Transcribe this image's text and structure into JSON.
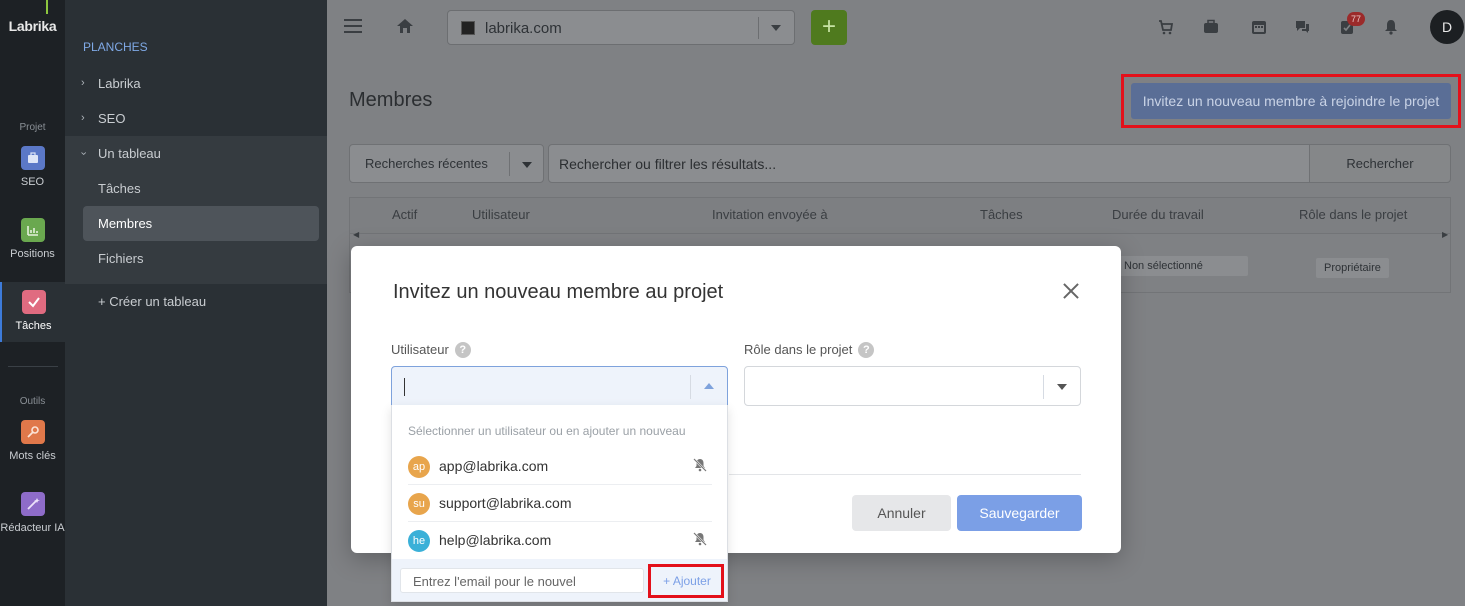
{
  "rail": {
    "logo": "Labrika",
    "section_project": "Projet",
    "items": [
      {
        "label": "SEO",
        "icon": "briefcase-icon",
        "color": "#5b78c7"
      },
      {
        "label": "Positions",
        "icon": "chart-icon",
        "color": "#6aa84f"
      },
      {
        "label": "Tâches",
        "icon": "check-icon",
        "color": "#e06b80"
      },
      {
        "label": "Mots clés",
        "icon": "key-icon",
        "color": "#e0784a"
      },
      {
        "label": "Rédacteur IA",
        "icon": "wand-icon",
        "color": "#8e6cc9"
      }
    ],
    "section_tools": "Outils"
  },
  "sidebar": {
    "heading": "PLANCHES",
    "boards": [
      {
        "label": "Labrika"
      },
      {
        "label": "SEO"
      },
      {
        "label": "Un tableau"
      }
    ],
    "sub_items": [
      {
        "label": "Tâches"
      },
      {
        "label": "Membres"
      },
      {
        "label": "Fichiers"
      }
    ],
    "create": "+ Créer un tableau"
  },
  "topbar": {
    "site": "labrika.com",
    "add_label": "+",
    "badge_count": "77",
    "avatar_initial": "D"
  },
  "page": {
    "title": "Membres",
    "invite_button": "Invitez un nouveau membre à rejoindre le projet",
    "recent_searches": "Recherches récentes",
    "search_placeholder": "Rechercher ou filtrer les résultats...",
    "search_button": "Rechercher",
    "columns": [
      "Actif",
      "Utilisateur",
      "Invitation envoyée à",
      "Tâches",
      "Durée du travail",
      "Rôle dans le projet"
    ],
    "row": {
      "duration": "Non sélectionné",
      "role": "Propriétaire"
    }
  },
  "modal": {
    "title": "Invitez un nouveau membre au projet",
    "user_label": "Utilisateur",
    "role_label": "Rôle dans le projet",
    "help_glyph": "?",
    "cancel": "Annuler",
    "save": "Sauvegarder"
  },
  "dropdown": {
    "hint": "Sélectionner un utilisateur ou en ajouter un nouveau",
    "users": [
      {
        "initials": "ap",
        "email": "app@labrika.com",
        "color": "#e8a54c",
        "muted": true
      },
      {
        "initials": "su",
        "email": "support@labrika.com",
        "color": "#e8a54c",
        "muted": false
      },
      {
        "initials": "he",
        "email": "help@labrika.com",
        "color": "#3ab0d8",
        "muted": true
      }
    ],
    "email_placeholder": "Entrez l'email pour le nouvel",
    "add_button": "+ Ajouter"
  },
  "colors": {
    "accent": "#7b9fe6",
    "highlight": "#e3101a",
    "add_green": "#4f7a1e"
  }
}
